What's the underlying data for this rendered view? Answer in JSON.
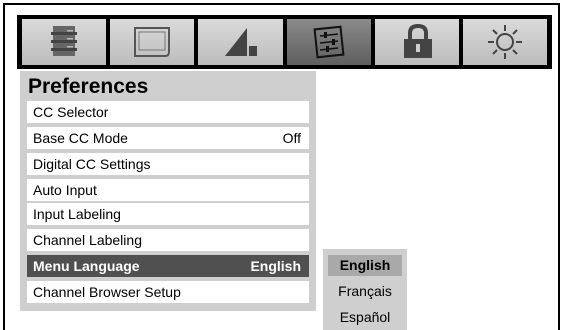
{
  "tabs": [
    {
      "icon": "stack-icon",
      "active": false
    },
    {
      "icon": "screen-icon",
      "active": false
    },
    {
      "icon": "speaker-icon",
      "active": false
    },
    {
      "icon": "preferences-icon",
      "active": true
    },
    {
      "icon": "lock-icon",
      "active": false
    },
    {
      "icon": "gear-icon",
      "active": false
    }
  ],
  "panel": {
    "title": "Preferences",
    "items": [
      {
        "label": "CC Selector",
        "value": ""
      },
      {
        "label": "Base CC Mode",
        "value": "Off"
      },
      {
        "label": "Digital CC Settings",
        "value": ""
      },
      {
        "label": "Auto Input",
        "value": ""
      },
      {
        "label": "Input Labeling",
        "value": ""
      },
      {
        "label": "Channel Labeling",
        "value": ""
      },
      {
        "label": "Menu Language",
        "value": "English",
        "selected": true
      },
      {
        "label": "Channel Browser Setup",
        "value": ""
      }
    ]
  },
  "language_popup": {
    "options": [
      "English",
      "Français",
      "Español"
    ],
    "current": "English"
  },
  "colors": {
    "selected_row": "#505050",
    "panel_bg": "#cfcfcf",
    "active_tab": "#6a6a6a"
  }
}
